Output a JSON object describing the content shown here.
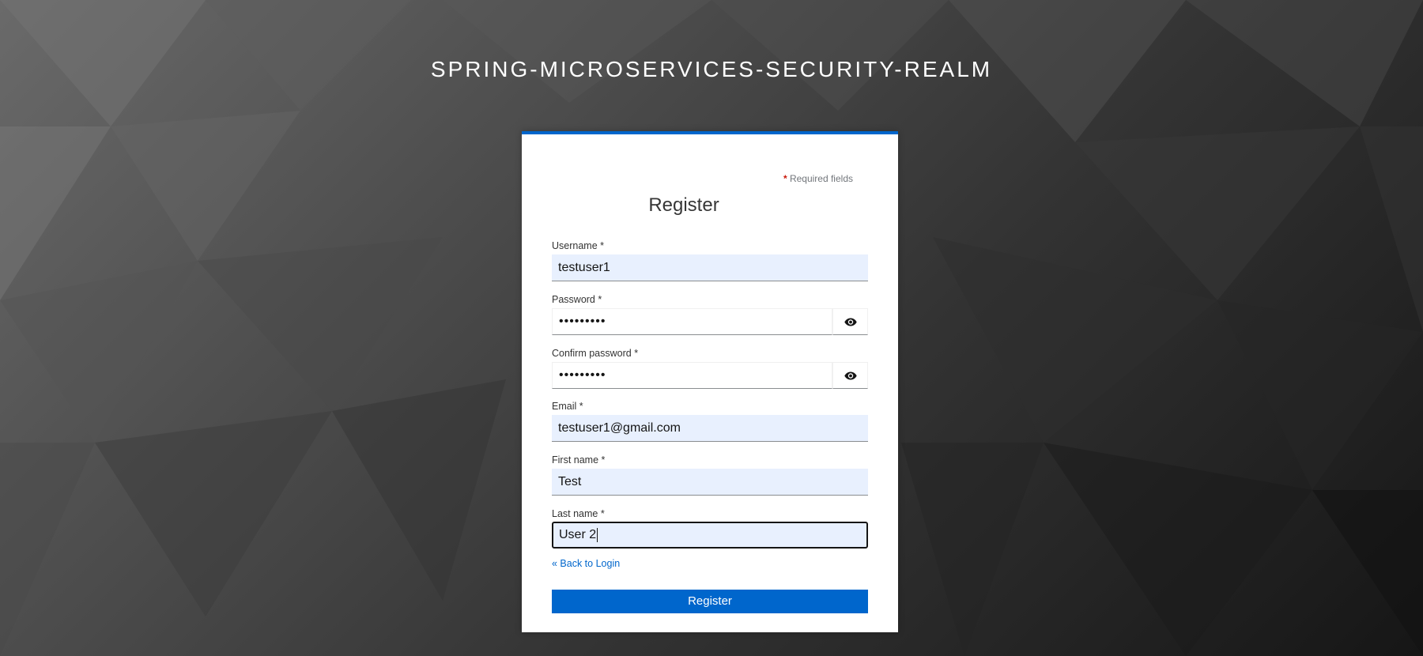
{
  "realm": {
    "title": "SPRING-MICROSERVICES-SECURITY-REALM"
  },
  "form": {
    "required_note_star": "*",
    "required_note_text": " Required fields",
    "heading": "Register",
    "fields": {
      "username": {
        "label": "Username *",
        "value": "testuser1"
      },
      "password": {
        "label": "Password *",
        "value": "•••••••••",
        "toggle_icon": "eye-icon"
      },
      "confirm_password": {
        "label": "Confirm password *",
        "value": "•••••••••",
        "toggle_icon": "eye-icon"
      },
      "email": {
        "label": "Email *",
        "value": "testuser1@gmail.com"
      },
      "first_name": {
        "label": "First name *",
        "value": "Test"
      },
      "last_name": {
        "label": "Last name *",
        "value": "User 2"
      }
    },
    "back_link": "« Back to Login",
    "submit_label": "Register"
  },
  "colors": {
    "accent": "#0066cc",
    "autofill_bg": "#e8f0fe",
    "required_star": "#c9190b"
  }
}
